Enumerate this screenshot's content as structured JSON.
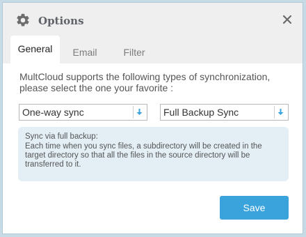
{
  "dialog": {
    "title": "Options",
    "icon": "gear-icon",
    "close_icon": "close-icon"
  },
  "tabs": [
    {
      "label": "General",
      "active": true
    },
    {
      "label": "Email",
      "active": false
    },
    {
      "label": "Filter",
      "active": false
    }
  ],
  "general": {
    "intro": "MultCloud supports the following types of synchronization, please select the one your favorite :",
    "sync_type": {
      "selected": "One-way sync",
      "icon": "arrow-down-icon"
    },
    "sync_mode": {
      "selected": "Full Backup Sync",
      "icon": "arrow-down-icon"
    },
    "info_title": "Sync via full backup:",
    "info_text": "Each time when you sync files, a subdirectory will be created in the target directory so that all the files in the source directory will be transferred to it."
  },
  "footer": {
    "save_label": "Save"
  },
  "colors": {
    "accent": "#3aa3dc",
    "info_bg": "#e3eef5",
    "titlebar_bg": "#efefef"
  }
}
